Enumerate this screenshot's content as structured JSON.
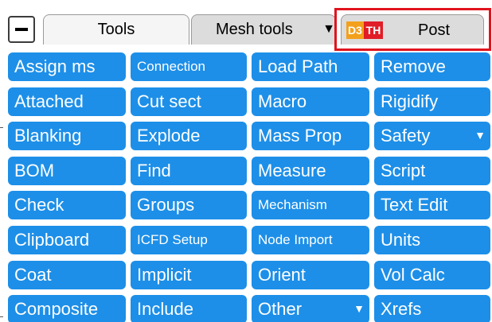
{
  "tabs": {
    "tools_label": "Tools",
    "mesh_label": "Mesh tools",
    "mesh_arrow": "▼",
    "post_label": "Post",
    "logo_d": "D3",
    "logo_t": "TH"
  },
  "colors": {
    "button_bg": "#1d8fe8",
    "highlight": "#e0141e",
    "logo_orange": "#f3a01c",
    "logo_red": "#e11d27"
  },
  "columns": [
    [
      {
        "label": "Assign ms"
      },
      {
        "label": "Attached"
      },
      {
        "label": "Blanking"
      },
      {
        "label": "BOM"
      },
      {
        "label": "Check"
      },
      {
        "label": "Clipboard"
      },
      {
        "label": "Coat"
      },
      {
        "label": "Composite"
      }
    ],
    [
      {
        "label": "Connection"
      },
      {
        "label": "Cut sect"
      },
      {
        "label": "Explode"
      },
      {
        "label": "Find"
      },
      {
        "label": "Groups"
      },
      {
        "label": "ICFD Setup"
      },
      {
        "label": "Implicit"
      },
      {
        "label": "Include"
      }
    ],
    [
      {
        "label": "Load Path"
      },
      {
        "label": "Macro"
      },
      {
        "label": "Mass Prop"
      },
      {
        "label": "Measure"
      },
      {
        "label": "Mechanism"
      },
      {
        "label": "Node Import"
      },
      {
        "label": "Orient"
      },
      {
        "label": "Other",
        "dropdown": "▼"
      }
    ],
    [
      {
        "label": "Remove"
      },
      {
        "label": "Rigidify"
      },
      {
        "label": "Safety",
        "dropdown": "▼"
      },
      {
        "label": "Script"
      },
      {
        "label": "Text Edit"
      },
      {
        "label": "Units"
      },
      {
        "label": "Vol Calc"
      },
      {
        "label": "Xrefs"
      }
    ]
  ]
}
